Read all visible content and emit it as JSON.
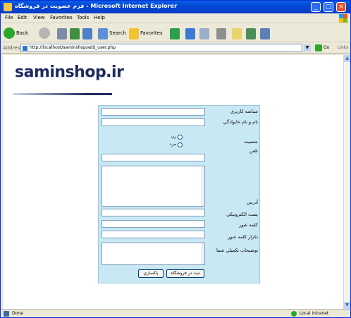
{
  "window": {
    "title": "فرم عضويت در فروشگاه - Microsoft Internet Explorer",
    "min": "_",
    "max": "□",
    "close": "×"
  },
  "menu": [
    "File",
    "Edit",
    "View",
    "Favorites",
    "Tools",
    "Help"
  ],
  "toolbar": {
    "back_label": "Back",
    "search_label": "Search",
    "favorites_label": "Favorites"
  },
  "address": {
    "label": "Address",
    "url": "http://localhost/saminshop/add_user.php",
    "go_label": "Go",
    "links_label": "Links"
  },
  "logo": {
    "text": "saminshop.ir"
  },
  "form": {
    "username_label": "شناسه كاربري",
    "password_label": "كلمه عبور",
    "password_confirm_label": "تكرار كلمه عبور",
    "name_label": "نام و نام خانوادگي",
    "gender_label": "جنسيت",
    "gender_options": [
      "زن",
      "مرد"
    ],
    "phone_label": "تلفن",
    "address_label": "آدرس",
    "email_label": "پست الكترونيكي",
    "description_label": "توضيحات تكميلي شما",
    "submit_label": "ثبت در فروشگاه",
    "reset_label": "پاكسازي"
  },
  "status": {
    "text": "Done",
    "zone": "Local intranet"
  },
  "colors": {
    "form_bg": "#C8E8F4",
    "logo": "#1E2A5E",
    "titlebar": "#0A5FE4"
  }
}
